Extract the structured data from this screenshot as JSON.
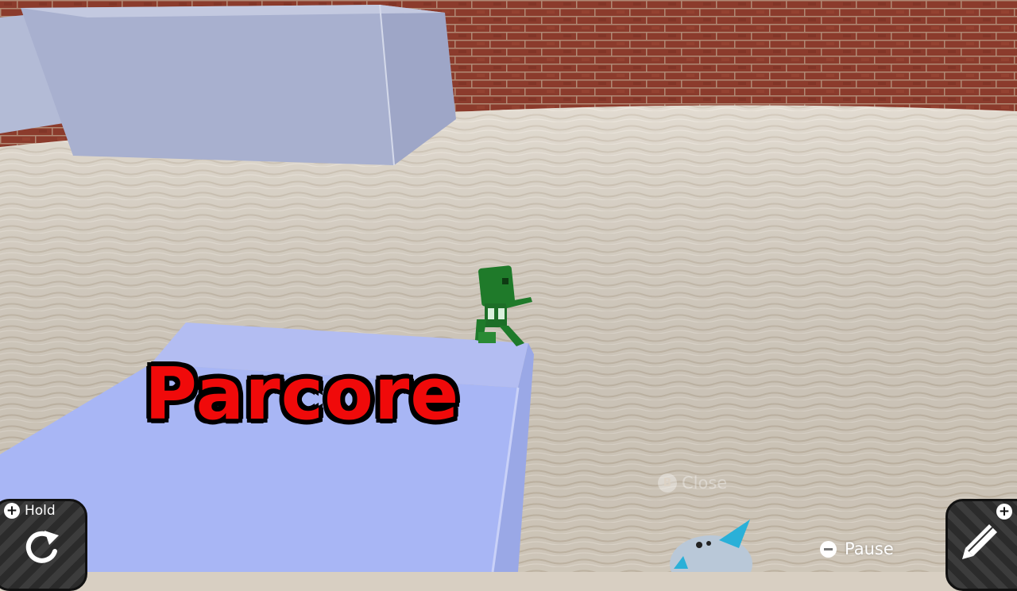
{
  "scene": {
    "title": "Parcore",
    "colors": {
      "title_fill": "#f00a0a",
      "title_outline": "#000000",
      "sand": "#d8cfc2",
      "brick": "#8a3a2a",
      "block": "#a9b6f0",
      "character": "#1f7a2a"
    }
  },
  "controls": {
    "hold": {
      "label": "Hold",
      "icon": "plus-icon",
      "action_icon": "rotate-icon"
    },
    "close": {
      "label": "Close",
      "button_glyph": "B"
    },
    "pause": {
      "label": "Pause",
      "icon": "minus-icon"
    },
    "edit": {
      "icon": "pencil-icon",
      "badge_icon": "plus-icon"
    }
  }
}
